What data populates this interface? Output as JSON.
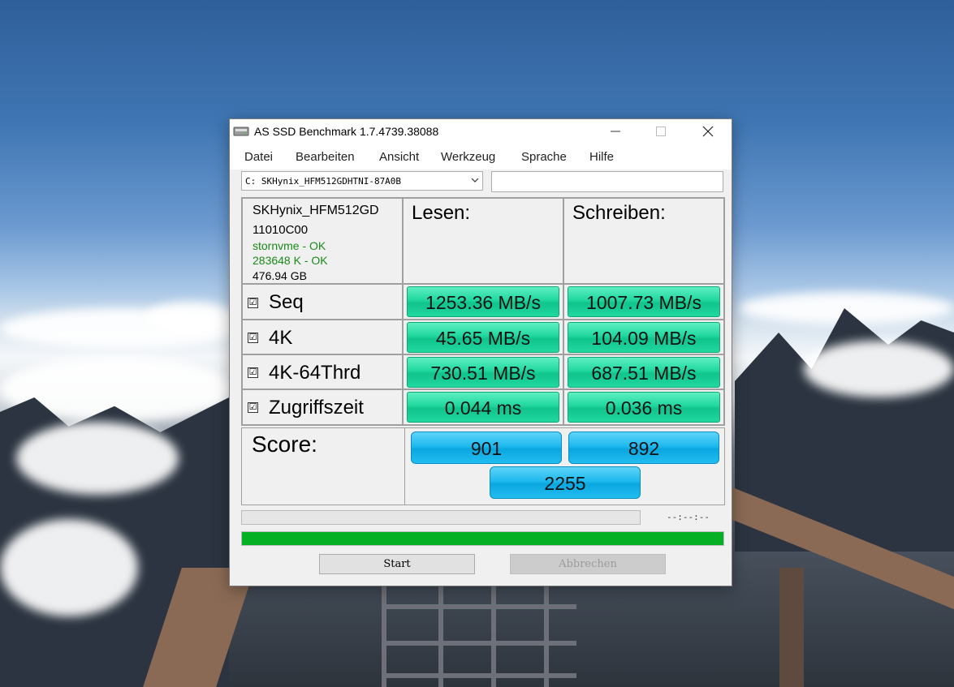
{
  "window": {
    "title": "AS SSD Benchmark 1.7.4739.38088",
    "minimize_icon": "minimize-icon",
    "maximize_icon": "maximize-icon",
    "close_icon": "close-icon"
  },
  "menu": [
    "Datei",
    "Bearbeiten",
    "Ansicht",
    "Werkzeug",
    "Sprache",
    "Hilfe"
  ],
  "drive_select": {
    "value": "C: SKHynix_HFM512GDHTNI-87A0B"
  },
  "drive_info": {
    "model": "SKHynix_HFM512GD",
    "firmware": "11010C00",
    "driver_status": "stornvme - OK",
    "alignment_status": "283648 K - OK",
    "capacity": "476.94 GB",
    "status_color": "#1a8a1a"
  },
  "headers": {
    "read": "Lesen:",
    "write": "Schreiben:"
  },
  "rows": [
    {
      "label": "Seq",
      "checked": "☑",
      "read": "1253.36 MB/s",
      "write": "1007.73 MB/s"
    },
    {
      "label": "4K",
      "checked": "☑",
      "read": "45.65 MB/s",
      "write": "104.09 MB/s"
    },
    {
      "label": "4K-64Thrd",
      "checked": "☑",
      "read": "730.51 MB/s",
      "write": "687.51 MB/s"
    },
    {
      "label": "Zugriffszeit",
      "checked": "☑",
      "read": "0.044 ms",
      "write": "0.036 ms"
    }
  ],
  "score": {
    "label": "Score:",
    "read": "901",
    "write": "892",
    "total": "2255"
  },
  "progress": {
    "time_text": "--:--:--",
    "main_progress": 1.0,
    "fill_color": "#06b025"
  },
  "buttons": {
    "start": "Start",
    "cancel": "Abbrechen"
  }
}
